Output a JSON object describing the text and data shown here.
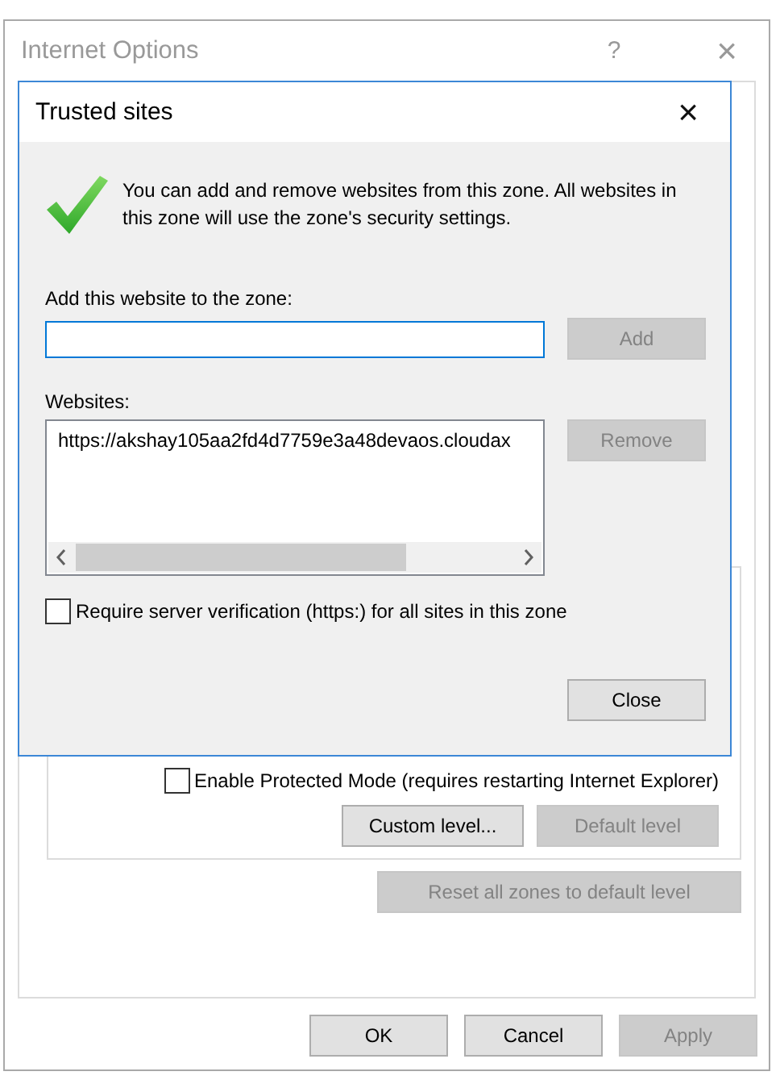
{
  "window": {
    "title": "Internet Options",
    "help": "?",
    "close": "×"
  },
  "zone_panel": {
    "protected_mode": {
      "label": "Enable Protected Mode (requires restarting Internet Explorer)",
      "checked": false
    },
    "buttons": [
      {
        "label": "Custom level...",
        "disabled": false
      },
      {
        "label": "Default level",
        "disabled": true
      }
    ]
  },
  "reset_button": {
    "label": "Reset all zones to default level",
    "disabled": true
  },
  "footer_buttons": [
    {
      "label": "OK",
      "disabled": false
    },
    {
      "label": "Cancel",
      "disabled": false
    },
    {
      "label": "Apply",
      "disabled": true
    }
  ],
  "dialog": {
    "title": "Trusted sites",
    "close": "×",
    "info": "You can add and remove websites from this zone. All websites in this zone will use the zone's security settings.",
    "add_label": "Add this website to the zone:",
    "add_button": {
      "label": "Add",
      "disabled": true
    },
    "websites_label": "Websites:",
    "websites": [
      "https://akshay105aa2fd4d7759e3a48devaos.cloudax"
    ],
    "remove_button": {
      "label": "Remove",
      "disabled": true
    },
    "require_verification": {
      "label": "Require server verification (https:) for all sites in this zone",
      "checked": false
    },
    "close_button": {
      "label": "Close",
      "disabled": false
    }
  }
}
